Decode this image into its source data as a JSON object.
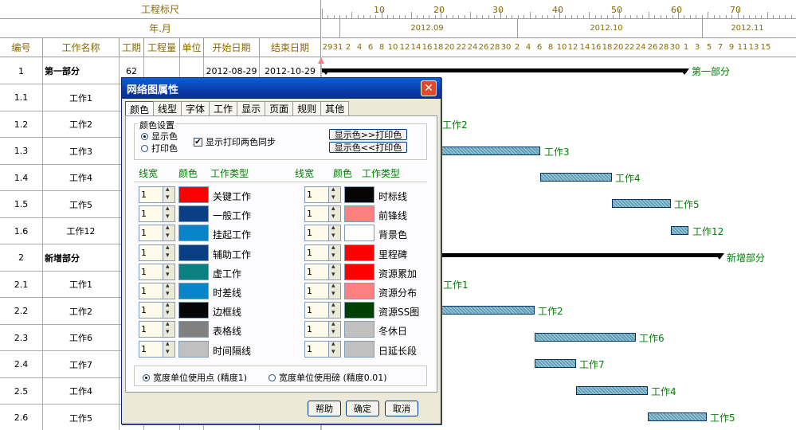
{
  "header": {
    "ruler_title": "工程标尺",
    "date_title": "年.月",
    "ruler_marks": [
      "10",
      "20",
      "30",
      "40",
      "50",
      "60",
      "70"
    ],
    "months": [
      "2012.09",
      "2012.10",
      "2012.11"
    ],
    "days": [
      "29",
      "31",
      "2",
      "4",
      "6",
      "8",
      "10",
      "12",
      "14",
      "16",
      "18",
      "20",
      "22",
      "24",
      "26",
      "28",
      "30",
      "2",
      "4",
      "6",
      "8",
      "10",
      "12",
      "14",
      "16",
      "18",
      "20",
      "22",
      "24",
      "26",
      "28",
      "30",
      "1",
      "3",
      "5",
      "7",
      "9",
      "11",
      "13",
      "15"
    ]
  },
  "columns": [
    "编号",
    "工作名称",
    "工期",
    "工程量",
    "单位",
    "开始日期",
    "结束日期"
  ],
  "rows": [
    {
      "no": "1",
      "name": "第一部分",
      "dur": "62",
      "start": "2012-08-29",
      "end": "2012-10-29",
      "bold": true
    },
    {
      "no": "1.1",
      "name": "工作1"
    },
    {
      "no": "1.2",
      "name": "工作2"
    },
    {
      "no": "1.3",
      "name": "工作3"
    },
    {
      "no": "1.4",
      "name": "工作4"
    },
    {
      "no": "1.5",
      "name": "工作5"
    },
    {
      "no": "1.6",
      "name": "工作12"
    },
    {
      "no": "2",
      "name": "新增部分",
      "bold": true
    },
    {
      "no": "2.1",
      "name": "工作1"
    },
    {
      "no": "2.2",
      "name": "工作2"
    },
    {
      "no": "2.3",
      "name": "工作6"
    },
    {
      "no": "2.4",
      "name": "工作7"
    },
    {
      "no": "2.5",
      "name": "工作4"
    },
    {
      "no": "2.6",
      "name": "工作5"
    }
  ],
  "gantt_labels": {
    "summary1": "第一部分",
    "bar1_2": "工作2",
    "bar1_3": "工作3",
    "bar1_4": "工作4",
    "bar1_5": "工作5",
    "bar1_6": "工作12",
    "summary2": "新增部分",
    "bar2_1": "工作1",
    "bar2_2": "工作2",
    "bar2_3": "工作6",
    "bar2_4": "工作7",
    "bar2_5": "工作4",
    "bar2_6": "工作5"
  },
  "dialog": {
    "title": "网络图属性",
    "close_label": "✕",
    "tabs": [
      "颜色",
      "线型",
      "字体",
      "工作",
      "显示",
      "页面",
      "规则",
      "其他"
    ],
    "color_settings": {
      "legend": "颜色设置",
      "radio_display": "显示色",
      "radio_print": "打印色",
      "sync_checkbox": "显示打印两色同步",
      "btn_to_print": "显示色>>打印色",
      "btn_to_display": "显示色<<打印色"
    },
    "column_headers": {
      "width": "线宽",
      "color": "颜色",
      "type": "工作类型"
    },
    "left_items": [
      {
        "value": "1",
        "label": "关键工作",
        "color": "#ff0000"
      },
      {
        "value": "1",
        "label": "一般工作",
        "color": "#0a3f86"
      },
      {
        "value": "1",
        "label": "挂起工作",
        "color": "#0884c8"
      },
      {
        "value": "1",
        "label": "辅助工作",
        "color": "#0a3f86"
      },
      {
        "value": "1",
        "label": "虚工作",
        "color": "#0a8080"
      },
      {
        "value": "1",
        "label": "时差线",
        "color": "#0884c8"
      },
      {
        "value": "1",
        "label": "边框线",
        "color": "#050505"
      },
      {
        "value": "1",
        "label": "表格线",
        "color": "#808080"
      },
      {
        "value": "1",
        "label": "时间隔线",
        "color": "#c0c0c0"
      }
    ],
    "right_items": [
      {
        "value": "1",
        "label": "时标线",
        "color": "#050505"
      },
      {
        "value": "1",
        "label": "前锋线",
        "color": "#ff8080"
      },
      {
        "value": "1",
        "label": "背景色",
        "color": "#ffffff"
      },
      {
        "value": "1",
        "label": "里程碑",
        "color": "#ff0000"
      },
      {
        "value": "1",
        "label": "资源累加",
        "color": "#ff0000"
      },
      {
        "value": "1",
        "label": "资源分布",
        "color": "#ff8080"
      },
      {
        "value": "1",
        "label": "资源SS图",
        "color": "#004000"
      },
      {
        "value": "1",
        "label": "冬休日",
        "color": "#c0c0c0"
      },
      {
        "value": "1",
        "label": "日延长段",
        "color": "#c0c0c0"
      }
    ],
    "unit_point": "宽度单位使用点 (精度1)",
    "unit_pound": "宽度单位使用磅 (精度0.01)",
    "btn_help": "帮助",
    "btn_ok": "确定",
    "btn_cancel": "取消"
  }
}
